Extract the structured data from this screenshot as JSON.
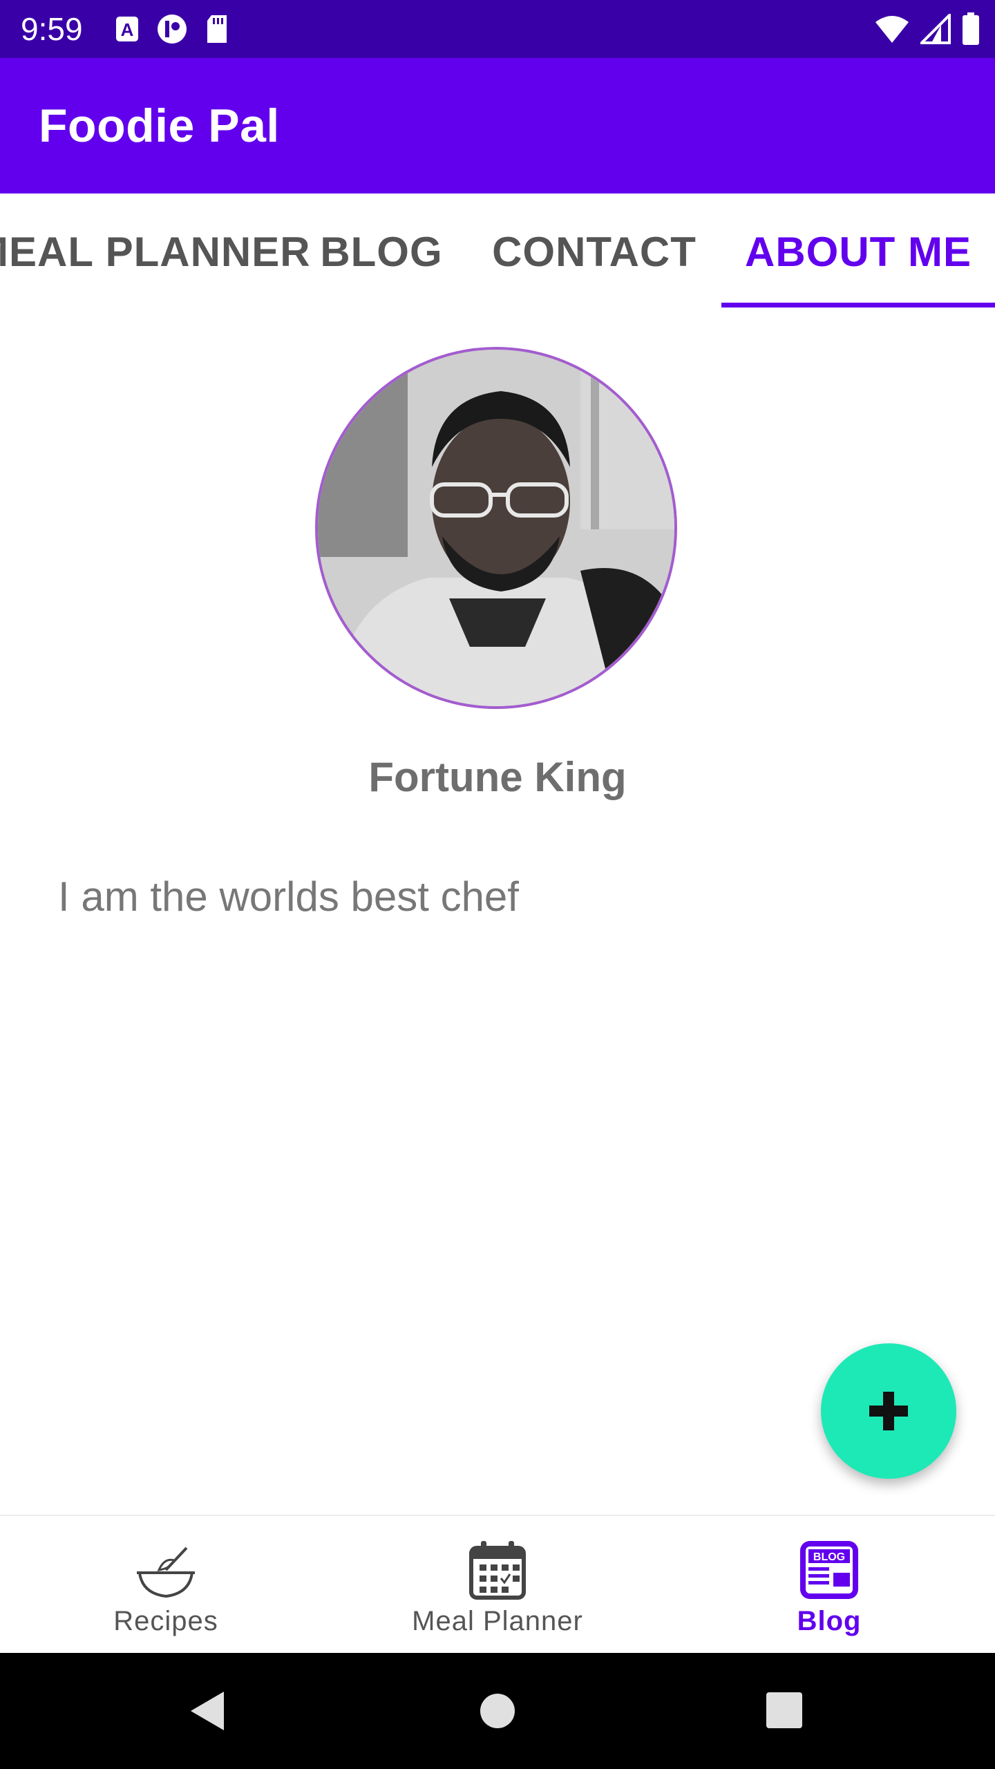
{
  "status_bar": {
    "time": "9:59",
    "left_icons": [
      "text-a-icon",
      "badge-icon",
      "sd-card-icon"
    ],
    "right_icons": [
      "wifi-icon",
      "signal-icon",
      "battery-icon"
    ]
  },
  "app_bar": {
    "title": "Foodie Pal",
    "color": "#6200ee"
  },
  "tabs": [
    {
      "label": "MEAL PLANNER",
      "active": false
    },
    {
      "label": "BLOG",
      "active": false
    },
    {
      "label": "CONTACT",
      "active": false
    },
    {
      "label": "ABOUT ME",
      "active": true
    }
  ],
  "profile": {
    "name": "Fortune King",
    "bio": "I am the worlds best chef",
    "avatar_border_color": "#a35ccf"
  },
  "fab": {
    "icon": "plus-icon",
    "color": "#1de9b6"
  },
  "bottom_nav": [
    {
      "label": "Recipes",
      "icon": "mixing-bowl-icon",
      "active": false
    },
    {
      "label": "Meal Planner",
      "icon": "calendar-icon",
      "active": false
    },
    {
      "label": "Blog",
      "icon": "blog-icon",
      "active": true
    }
  ],
  "system_nav": [
    "back-icon",
    "home-icon",
    "recents-icon"
  ]
}
